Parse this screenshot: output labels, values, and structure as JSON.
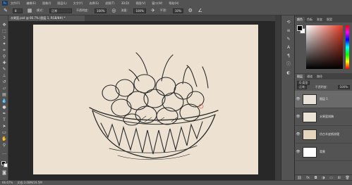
{
  "menubar": {
    "logo": "Ps",
    "items": [
      "文件(F)",
      "编辑(E)",
      "图像(I)",
      "图层(L)",
      "文字(Y)",
      "选择(S)",
      "滤镜(T)",
      "3D(D)",
      "视图(V)",
      "窗口(W)",
      "帮助(H)"
    ]
  },
  "options": {
    "size": "8",
    "mode_label": "模式：",
    "mode_value": "正常",
    "opacity_label": "不透明度：",
    "opacity_value": "100%",
    "flow_label": "流量：",
    "flow_value": "100%",
    "smooth_label": "平滑：",
    "smooth_value": "10%"
  },
  "document_tab": "水果篮.psd @ 66.7% (图层 1, RGB/8#) *",
  "status": {
    "zoom": "66.67%",
    "doc": "文档:3.08M/19.5M"
  },
  "panels": {
    "top_tabs": [
      "颜色",
      "色板",
      "渐变",
      "图案"
    ],
    "layer_tabs": [
      "图层",
      "通道",
      "路径"
    ],
    "kind_label": "Q 类型",
    "blend_mode": "正常",
    "opacity_label": "不透明度：",
    "opacity_value": "100%",
    "lock_label": "锁定：",
    "fill_label": "填充：",
    "fill_value": "100%",
    "layers": [
      {
        "name": "图层 1",
        "selected": true,
        "thumb": "#e8e2d8"
      },
      {
        "name": "水果篮线稿",
        "selected": false,
        "thumb": "#ece4d6"
      },
      {
        "name": "仿古羊皮纸纹理",
        "selected": false,
        "thumb": "#e6d6bd"
      },
      {
        "name": "背景",
        "selected": false,
        "thumb": "#ffffff"
      }
    ]
  },
  "colors": {
    "canvas": "#ede2d2",
    "pencil": "#2a2a2a",
    "accent_mark": "#d96a5a"
  }
}
